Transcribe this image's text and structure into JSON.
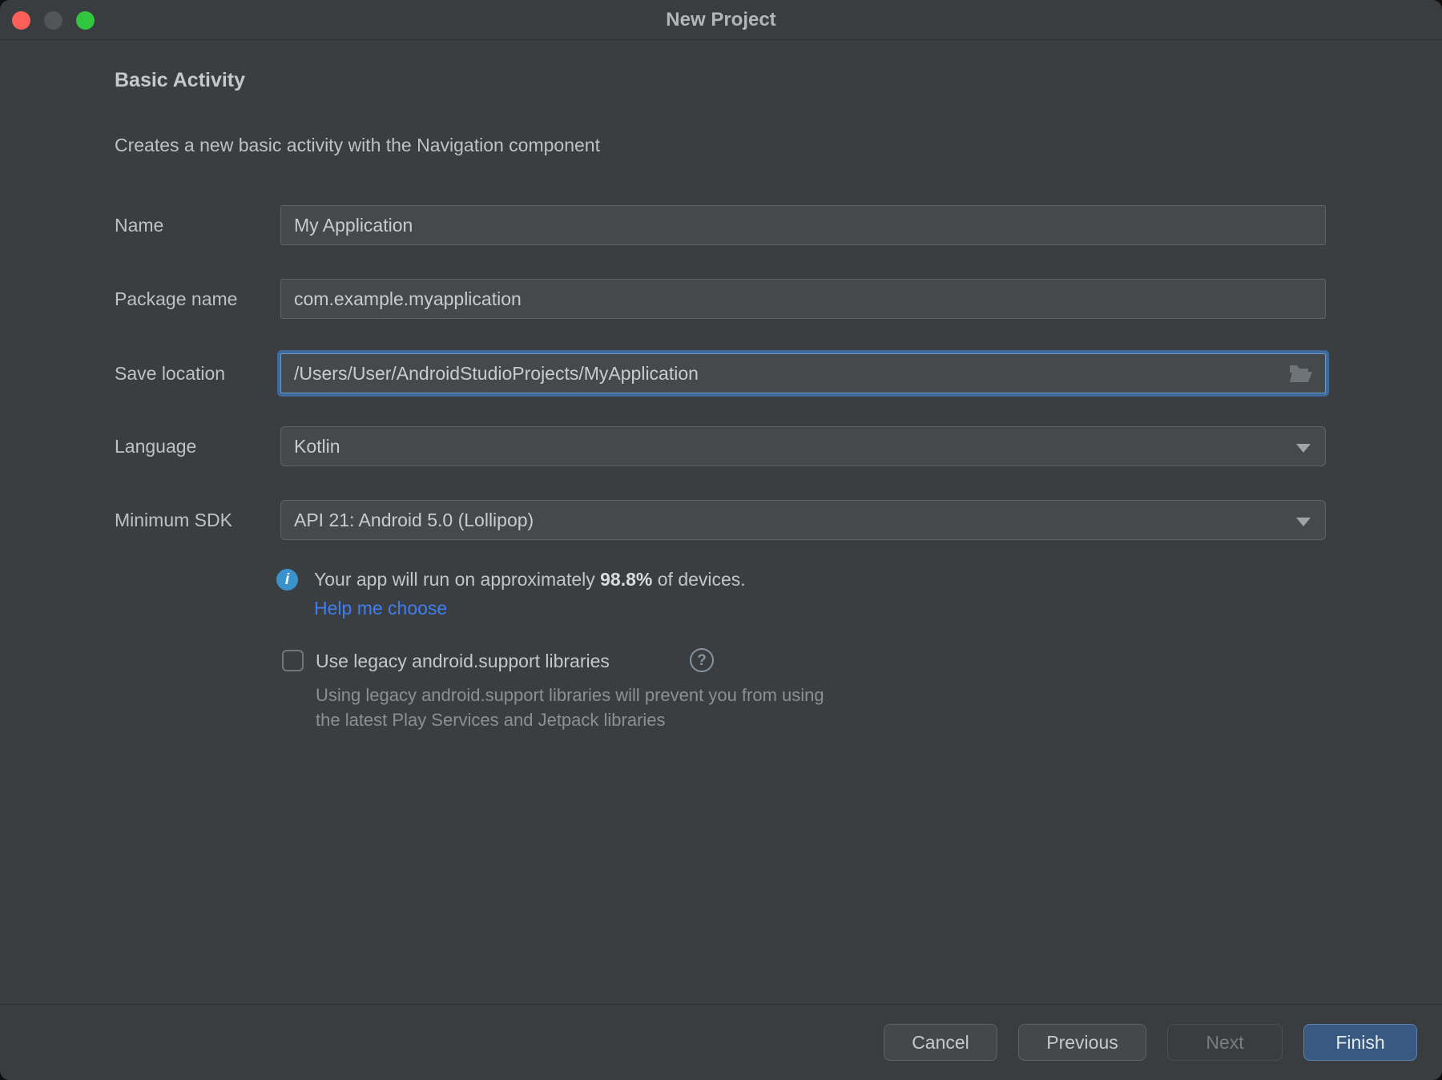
{
  "window": {
    "title": "New Project"
  },
  "header": {
    "title": "Basic Activity",
    "description": "Creates a new basic activity with the Navigation component"
  },
  "form": {
    "name": {
      "label": "Name",
      "value": "My Application"
    },
    "package_name": {
      "label": "Package name",
      "value": "com.example.myapplication"
    },
    "save_location": {
      "label": "Save location",
      "value": "/Users/User/AndroidStudioProjects/MyApplication"
    },
    "language": {
      "label": "Language",
      "value": "Kotlin"
    },
    "minimum_sdk": {
      "label": "Minimum SDK",
      "value": "API 21: Android 5.0 (Lollipop)"
    }
  },
  "sdk_info": {
    "text_before": "Your app will run on approximately ",
    "percentage": "98.8%",
    "text_after": " of devices.",
    "link_label": "Help me choose",
    "info_icon_glyph": "i"
  },
  "legacy_checkbox": {
    "checked": false,
    "label": "Use legacy android.support libraries",
    "help_icon_glyph": "?",
    "description_line1": "Using legacy android.support libraries will prevent you from using",
    "description_line2": "the latest Play Services and Jetpack libraries"
  },
  "footer": {
    "cancel_label": "Cancel",
    "previous_label": "Previous",
    "next_label": "Next",
    "finish_label": "Finish"
  },
  "colors": {
    "window_background": "#3b3e41",
    "field_background": "#46494b",
    "focus_ring_blue": "#3d6a9b",
    "link_blue": "#3f7ef0",
    "info_icon_blue": "#3a92cc",
    "finish_button_blue": "#385a82",
    "traffic_red": "#fb5f57",
    "traffic_gray": "#525557",
    "traffic_green": "#30c63e"
  }
}
